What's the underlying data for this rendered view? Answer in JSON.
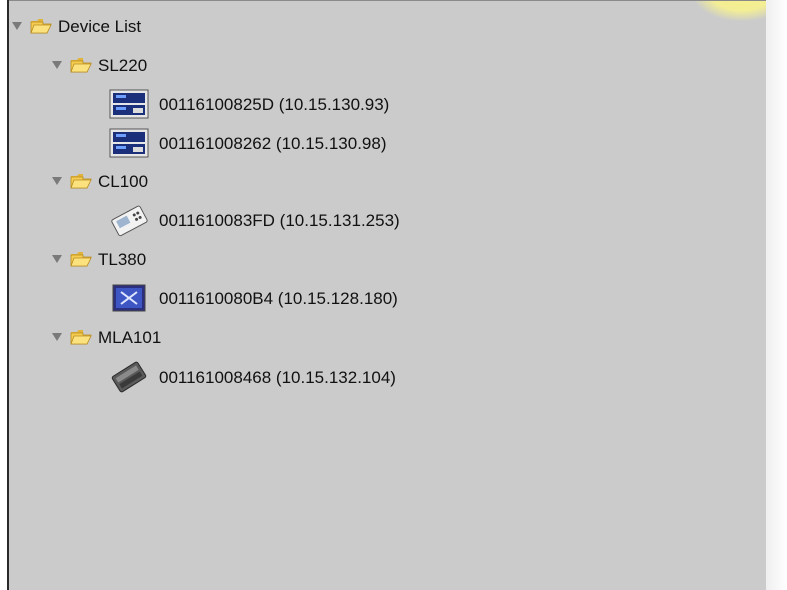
{
  "tree": {
    "root": {
      "label": "Device List",
      "icon": "folder-open-icon",
      "expanded": true
    },
    "groups": [
      {
        "label": "SL220",
        "icon": "folder-open-icon",
        "expanded": true,
        "devices": [
          {
            "label": "00116100825D (10.15.130.93)",
            "icon": "rack-device-icon"
          },
          {
            "label": "001161008262 (10.15.130.98)",
            "icon": "rack-device-icon"
          }
        ]
      },
      {
        "label": "CL100",
        "icon": "folder-open-icon",
        "expanded": true,
        "devices": [
          {
            "label": "0011610083FD (10.15.131.253)",
            "icon": "handheld-device-icon"
          }
        ]
      },
      {
        "label": "TL380",
        "icon": "folder-open-icon",
        "expanded": true,
        "devices": [
          {
            "label": "0011610080B4 (10.15.128.180)",
            "icon": "panel-device-icon"
          }
        ]
      },
      {
        "label": "MLA101",
        "icon": "folder-open-icon",
        "expanded": true,
        "devices": [
          {
            "label": "001161008468 (10.15.132.104)",
            "icon": "module-device-icon"
          }
        ]
      }
    ]
  },
  "colors": {
    "panel_bg": "#cbcbcb",
    "text": "#111111",
    "folder": "#f4cd52",
    "highlight_glow": "#f3ee95"
  }
}
